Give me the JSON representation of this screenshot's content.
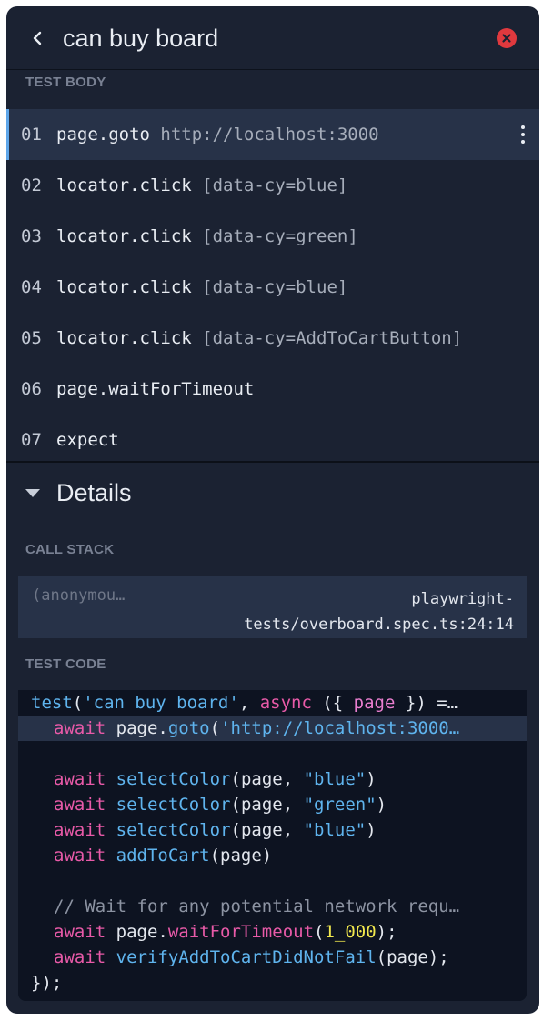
{
  "header": {
    "title": "can buy board"
  },
  "test_body": {
    "label": "TEST BODY",
    "steps": [
      {
        "num": "01",
        "cmd": "page.goto",
        "arg": "http://localhost:3000"
      },
      {
        "num": "02",
        "cmd": "locator.click",
        "arg": "[data-cy=blue]"
      },
      {
        "num": "03",
        "cmd": "locator.click",
        "arg": "[data-cy=green]"
      },
      {
        "num": "04",
        "cmd": "locator.click",
        "arg": "[data-cy=blue]"
      },
      {
        "num": "05",
        "cmd": "locator.click",
        "arg": "[data-cy=AddToCartButton]"
      },
      {
        "num": "06",
        "cmd": "page.waitForTimeout",
        "arg": ""
      },
      {
        "num": "07",
        "cmd": "expect",
        "arg": ""
      }
    ]
  },
  "details": {
    "title": "Details",
    "call_stack_label": "CALL STACK",
    "call_stack": {
      "fn": "(anonymou…",
      "file_line1": "playwright-",
      "file_line2": "tests/overboard.spec.ts:24:14"
    },
    "test_code_label": "TEST CODE",
    "code": {
      "l1_kw1": "test",
      "l1_p1": "(",
      "l1_str": "'can buy board'",
      "l1_p2": ", ",
      "l1_kw2": "async",
      "l1_p3": " ({ ",
      "l1_page": "page",
      "l1_p4": " }) =…",
      "l2_await": "await",
      "l2_obj": "page.",
      "l2_fn": "goto",
      "l2_p": "(",
      "l2_str": "'http://localhost:3000…",
      "l4_await": "await",
      "l4_fn": "selectColor",
      "l4_p": "(page, ",
      "l4_str": "\"blue\"",
      "l4_end": ")",
      "l5_await": "await",
      "l5_fn": "selectColor",
      "l5_p": "(page, ",
      "l5_str": "\"green\"",
      "l5_end": ")",
      "l6_await": "await",
      "l6_fn": "selectColor",
      "l6_p": "(page, ",
      "l6_str": "\"blue\"",
      "l6_end": ")",
      "l7_await": "await",
      "l7_fn": "addToCart",
      "l7_p": "(page)",
      "l9_cmt": "// Wait for any potential network requ…",
      "l10_await": "await",
      "l10_obj": "page.",
      "l10_fn": "waitForTimeout",
      "l10_p": "(",
      "l10_num": "1_000",
      "l10_end": ");",
      "l11_await": "await",
      "l11_fn": "verifyAddToCartDidNotFail",
      "l11_p": "(page);",
      "l12": "});"
    }
  },
  "colors": {
    "panel": "#1b2232",
    "accent": "#5ea6ea",
    "close": "#e0393e",
    "code_bg": "#0d1321"
  }
}
